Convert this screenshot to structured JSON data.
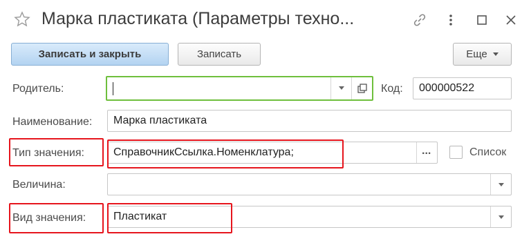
{
  "window": {
    "title": "Марка пластиката (Параметры техно...",
    "icons": [
      "star-icon",
      "link-icon",
      "more-vertical-icon",
      "maximize-icon",
      "close-icon"
    ]
  },
  "toolbar": {
    "save_close_label": "Записать и закрыть",
    "save_label": "Записать",
    "more_label": "Еще"
  },
  "form": {
    "parent": {
      "label": "Родитель:",
      "value": ""
    },
    "code": {
      "label": "Код:",
      "value": "000000522"
    },
    "name": {
      "label": "Наименование:",
      "value": "Марка пластиката"
    },
    "value_type": {
      "label": "Тип значения:",
      "value": "СправочникСсылка.Номенклатура;",
      "list_label": "Список",
      "list_checked": false
    },
    "quantity": {
      "label": "Величина:",
      "value": ""
    },
    "value_kind": {
      "label": "Вид значения:",
      "value": "Пластикат"
    }
  },
  "colors": {
    "primary_button": "#b3d3f1",
    "focus_border": "#6ebf3c",
    "highlight_box": "#e6141c"
  }
}
